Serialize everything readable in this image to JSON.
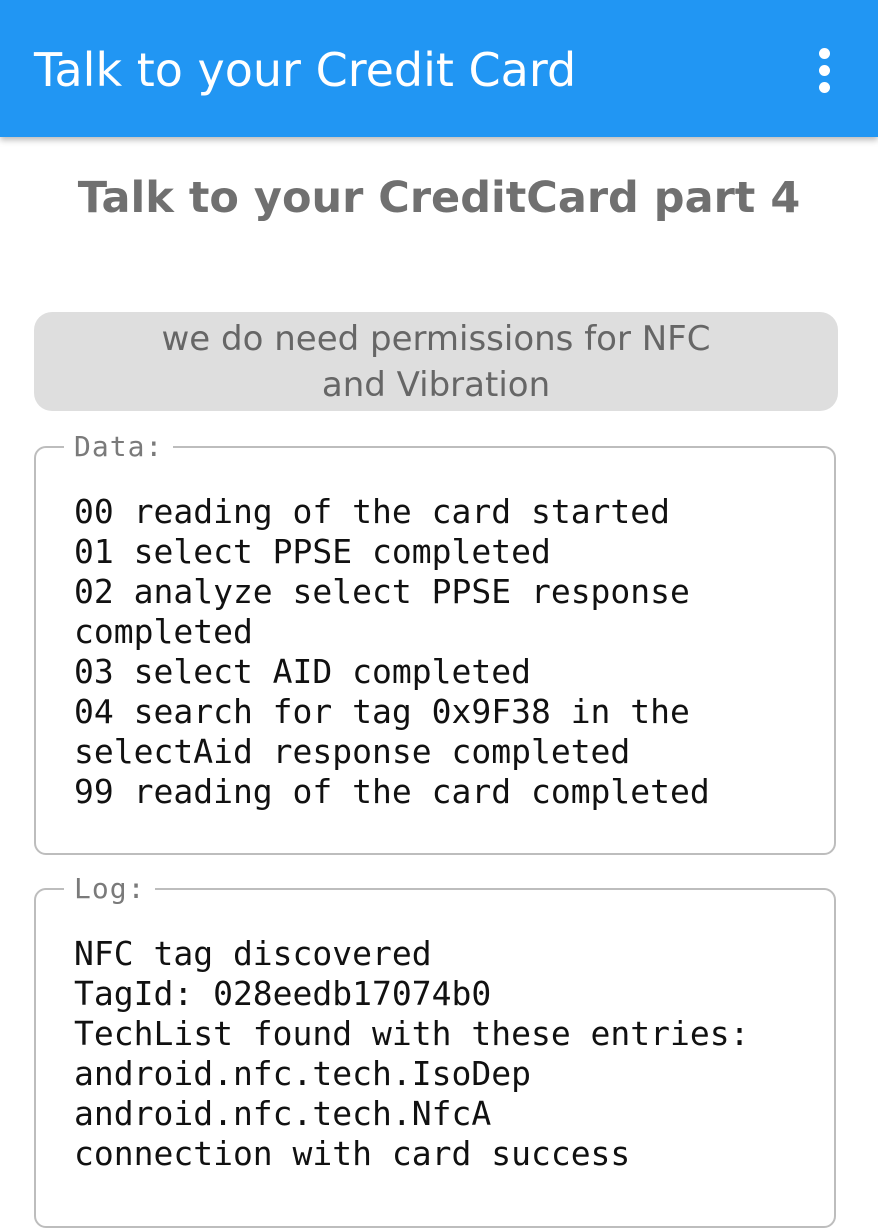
{
  "appbar": {
    "title": "Talk to your Credit Card",
    "menu_icon": "more-vert-icon"
  },
  "colors": {
    "appbar": "#2196F3",
    "heading_text": "#707070",
    "button_bg": "#DEDEDE",
    "button_text": "#666666",
    "fieldset_border": "#BDBDBD"
  },
  "main": {
    "heading": "Talk to your CreditCard part 4",
    "permissions_button": {
      "line1": "we do need permissions for NFC",
      "line2": "and Vibration"
    },
    "data_box": {
      "legend": "Data:",
      "lines": [
        "00 reading of the card started",
        "01 select PPSE completed",
        "02 analyze select PPSE response",
        "completed",
        "03 select AID completed",
        "04 search for tag 0x9F38 in the",
        "selectAid response completed",
        "99 reading of the card completed"
      ]
    },
    "log_box": {
      "legend": "Log:",
      "lines": [
        "NFC tag discovered",
        "TagId: 028eedb17074b0",
        "TechList found with these entries:",
        "android.nfc.tech.IsoDep",
        "android.nfc.tech.NfcA",
        "connection with card success"
      ]
    }
  }
}
